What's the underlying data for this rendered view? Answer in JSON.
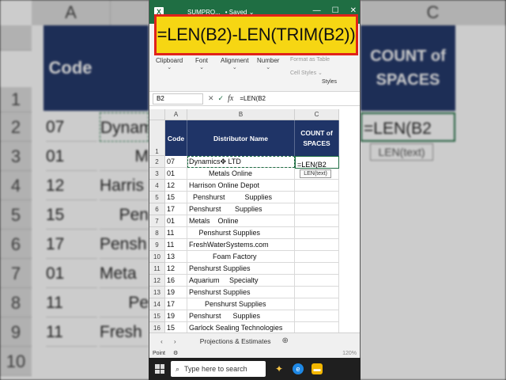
{
  "callout": {
    "formula": "=LEN(B2)-LEN(TRIM(B2))"
  },
  "titlebar": {
    "app_icon": "X",
    "filename": "SUMPRO...",
    "saved": "• Saved ⌄",
    "minimize": "—",
    "maximize": "☐",
    "close": "✕"
  },
  "ribbon": {
    "groups": [
      {
        "label": "Clipboard"
      },
      {
        "label": "Font"
      },
      {
        "label": "Alignment"
      },
      {
        "label": "Number"
      }
    ],
    "format_as_table": "Format as Table",
    "cell_styles": "Cell Styles ⌄",
    "styles_label": "Styles"
  },
  "formula_bar": {
    "name_box": "B2",
    "cancel": "✕",
    "enter": "✓",
    "fx": "fx",
    "content": "=LEN(B2"
  },
  "columns": [
    "A",
    "B",
    "C"
  ],
  "headers": {
    "code": "Code",
    "name": "Distributor Name",
    "count": "COUNT of SPACES"
  },
  "editing": {
    "formula": "=LEN(B2",
    "tooltip": "LEN(text)"
  },
  "rows": [
    {
      "n": "2",
      "code": "07",
      "name": "Dynamics✥ LTD"
    },
    {
      "n": "3",
      "code": "01",
      "name": "          Metals Online"
    },
    {
      "n": "4",
      "code": "12",
      "name": "Harrison Online Depot"
    },
    {
      "n": "5",
      "code": "15",
      "name": "  Penshurst          Supplies"
    },
    {
      "n": "6",
      "code": "17",
      "name": "Penshurst       Supplies"
    },
    {
      "n": "7",
      "code": "01",
      "name": "Metals    Online"
    },
    {
      "n": "8",
      "code": "11",
      "name": "     Penshurst Supplies"
    },
    {
      "n": "9",
      "code": "11",
      "name": "FreshWaterSystems.com"
    },
    {
      "n": "10",
      "code": "13",
      "name": "            Foam Factory"
    },
    {
      "n": "11",
      "code": "12",
      "name": "Penshurst Supplies"
    },
    {
      "n": "12",
      "code": "16",
      "name": "Aquarium     Specialty"
    },
    {
      "n": "13",
      "code": "19",
      "name": "Penshurst Supplies"
    },
    {
      "n": "14",
      "code": "17",
      "name": "        Penshurst Supplies"
    },
    {
      "n": "15",
      "code": "19",
      "name": "Penshurst      Supplies"
    },
    {
      "n": "16",
      "code": "15",
      "name": "Garlock Sealing Technologies"
    }
  ],
  "sheet_tab": "Projections & Estimates",
  "status": {
    "mode": "Point",
    "zoom": "120%"
  },
  "taskbar": {
    "search_placeholder": "Type here to search"
  },
  "background": {
    "columns": [
      "A",
      "",
      "C"
    ],
    "header_code": "Code",
    "header_count": "COUNT of SPACES",
    "row_numbers": [
      "1",
      "2",
      "3",
      "4",
      "5",
      "6",
      "7",
      "8",
      "9",
      "10",
      "11",
      "12"
    ],
    "codes": [
      "07",
      "01",
      "12",
      "15",
      "17",
      "01",
      "11",
      "11"
    ],
    "names": [
      "Dynam",
      "M",
      "Harris",
      "Pen",
      "Pensh",
      "Meta",
      "Pe",
      "Fresh"
    ],
    "formula": "=LEN(B2",
    "tooltip": "LEN(text)"
  },
  "colors": {
    "accent": "#1f6e43",
    "header_blue": "#1f3467",
    "callout_yellow": "#f6d613",
    "callout_border": "#e0221a"
  }
}
